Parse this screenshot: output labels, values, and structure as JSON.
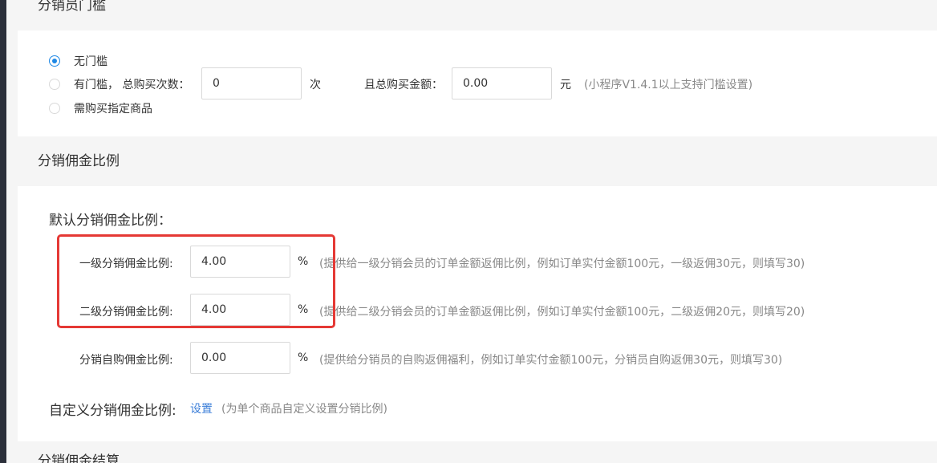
{
  "threshold": {
    "header": "分销员门槛",
    "options": [
      {
        "label": "无门槛",
        "selected": true
      },
      {
        "label": "有门槛， 总购买次数：",
        "selected": false
      },
      {
        "label": "需购买指定商品",
        "selected": false
      }
    ],
    "purchase_count_value": "0",
    "purchase_count_unit": "次",
    "amount_label": "且总购买金额：",
    "amount_value": "0.00",
    "amount_unit": "元",
    "amount_hint": "(小程序V1.4.1以上支持门槛设置)"
  },
  "commission": {
    "header": "分销佣金比例",
    "default_label": "默认分销佣金比例：",
    "rows": [
      {
        "label": "一级分销佣金比例:",
        "value": "4.00",
        "unit": "%",
        "hint": "(提供给一级分销会员的订单金额返佣比例，例如订单实付金额100元，一级返佣30元，则填写30)"
      },
      {
        "label": "二级分销佣金比例:",
        "value": "4.00",
        "unit": "%",
        "hint": "(提供给二级分销会员的订单金额返佣比例，例如订单实付金额100元，二级返佣20元，则填写20)"
      },
      {
        "label": "分销自购佣金比例:",
        "value": "0.00",
        "unit": "%",
        "hint": "(提供给分销员的自购返佣福利，例如订单实付金额100元，分销员自购返佣30元，则填写30)"
      }
    ],
    "custom_label": "自定义分销佣金比例:",
    "custom_link": "设置",
    "custom_hint": "(为单个商品自定义设置分销比例)"
  },
  "settlement": {
    "header": "分销佣金结算"
  },
  "colors": {
    "accent": "#1e88e5",
    "link": "#3d7fd8",
    "highlight": "#e53935",
    "section_bg": "#f5f5f5"
  }
}
